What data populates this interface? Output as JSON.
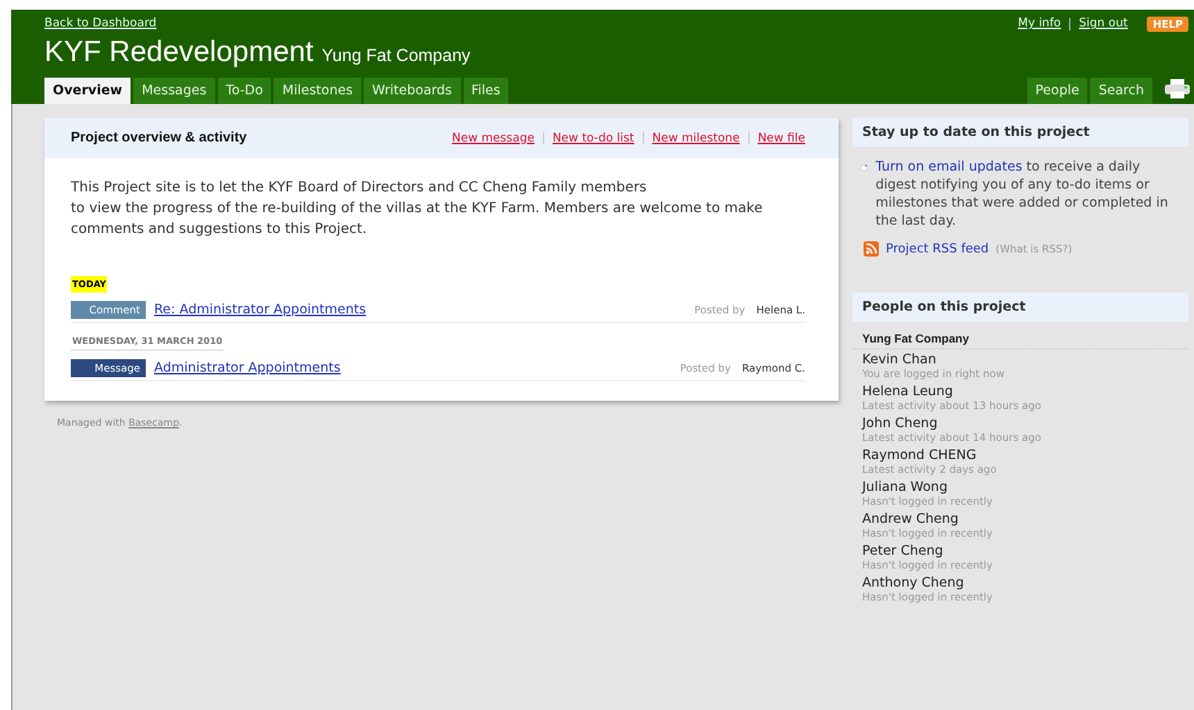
{
  "header": {
    "back_link": "Back to Dashboard",
    "title": "KYF Redevelopment",
    "company": "Yung Fat Company",
    "user_links": [
      "My info",
      "Sign out"
    ],
    "help": "HELP"
  },
  "tabs": [
    {
      "label": "Overview",
      "selected": true
    },
    {
      "label": "Messages",
      "selected": false
    },
    {
      "label": "To-Do",
      "selected": false
    },
    {
      "label": "Milestones",
      "selected": false
    },
    {
      "label": "Writeboards",
      "selected": false
    },
    {
      "label": "Files",
      "selected": false
    }
  ],
  "right_tabs": [
    {
      "label": "People",
      "selected": false
    },
    {
      "label": "Search",
      "selected": false
    }
  ],
  "overview": {
    "title": "Project overview & activity",
    "actions": [
      "New message",
      "New to-do list",
      "New milestone",
      "New file"
    ],
    "description": "This Project site is to let the KYF Board of Directors and CC Cheng Family members\nto view the progress of the re-building of the villas at the KYF Farm. Members are welcome to make comments and suggestions to this Project.",
    "groups": [
      {
        "date": "TODAY",
        "highlight": true,
        "items": [
          {
            "kind": "comment",
            "badge": "Comment",
            "title": "Re: Administrator Appointments",
            "posted_by": "Posted by",
            "author": "Helena L."
          }
        ]
      },
      {
        "date": "WEDNESDAY, 31 MARCH 2010",
        "highlight": false,
        "items": [
          {
            "kind": "message",
            "badge": "Message",
            "title": "Administrator Appointments",
            "posted_by": "Posted by",
            "author": "Raymond C."
          }
        ]
      }
    ]
  },
  "footer": {
    "prefix": "Managed with ",
    "link": "Basecamp",
    "suffix": "."
  },
  "updates": {
    "title": "Stay up to date on this project",
    "email_link": "Turn on email updates",
    "email_text": " to receive a daily digest notifying you of any to-do items or milestones that were added or completed in the last day.",
    "rss_link": "Project RSS feed",
    "rss_help": "(What is RSS?)"
  },
  "people": {
    "title": "People on this project",
    "company": "Yung Fat Company",
    "members": [
      {
        "name": "Kevin Chan",
        "status": "You are logged in right now"
      },
      {
        "name": "Helena Leung",
        "status": "Latest activity about 13 hours ago"
      },
      {
        "name": "John Cheng",
        "status": "Latest activity about 14 hours ago"
      },
      {
        "name": "Raymond CHENG",
        "status": "Latest activity 2 days ago"
      },
      {
        "name": "Juliana Wong",
        "status": "Hasn't logged in recently"
      },
      {
        "name": "Andrew Cheng",
        "status": "Hasn't logged in recently"
      },
      {
        "name": "Peter Cheng",
        "status": "Hasn't logged in recently"
      },
      {
        "name": "Anthony Cheng",
        "status": "Hasn't logged in recently"
      }
    ]
  }
}
